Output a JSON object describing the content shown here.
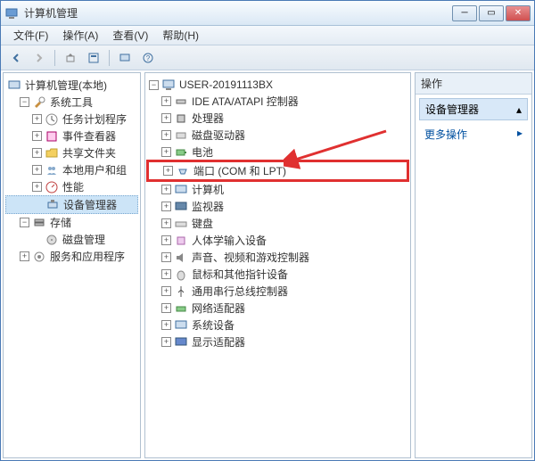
{
  "window": {
    "title": "计算机管理"
  },
  "menu": {
    "file": "文件(F)",
    "action": "操作(A)",
    "view": "查看(V)",
    "help": "帮助(H)"
  },
  "left_tree": {
    "root": "计算机管理(本地)",
    "system_tools": "系统工具",
    "task_scheduler": "任务计划程序",
    "event_viewer": "事件查看器",
    "shared_folders": "共享文件夹",
    "local_users": "本地用户和组",
    "performance": "性能",
    "device_manager": "设备管理器",
    "storage": "存储",
    "disk_management": "磁盘管理",
    "services_apps": "服务和应用程序"
  },
  "mid_tree": {
    "computer": "USER-20191113BX",
    "ide": "IDE ATA/ATAPI 控制器",
    "processors": "处理器",
    "disk_drives": "磁盘驱动器",
    "batteries": "电池",
    "ports": "端口 (COM 和 LPT)",
    "computers": "计算机",
    "monitors": "监视器",
    "keyboards": "键盘",
    "hid": "人体学输入设备",
    "sound": "声音、视频和游戏控制器",
    "mice": "鼠标和其他指针设备",
    "usb": "通用串行总线控制器",
    "network": "网络适配器",
    "system_devices": "系统设备",
    "display": "显示适配器"
  },
  "actions": {
    "header": "操作",
    "section": "设备管理器",
    "more": "更多操作"
  }
}
